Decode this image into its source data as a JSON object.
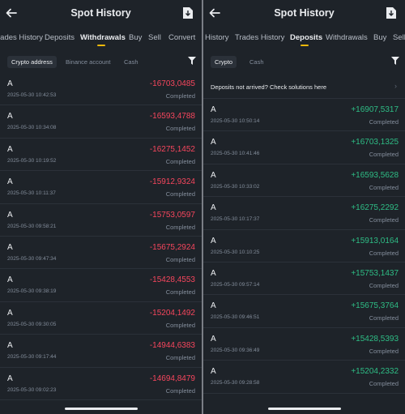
{
  "left": {
    "title": "Spot History",
    "tabs": [
      "rades History",
      "Deposits",
      "Withdrawals",
      "Buy",
      "Sell",
      "Convert"
    ],
    "filters": [
      "Crypto address",
      "Binance account",
      "Cash"
    ],
    "rows": [
      {
        "asset": "A",
        "time": "2025-05-30 10:42:53",
        "amount": "-16703,0485",
        "status": "Completed"
      },
      {
        "asset": "A",
        "time": "2025-05-30 10:34:08",
        "amount": "-16593,4788",
        "status": "Completed"
      },
      {
        "asset": "A",
        "time": "2025-05-30 10:19:52",
        "amount": "-16275,1452",
        "status": "Completed"
      },
      {
        "asset": "A",
        "time": "2025-05-30 10:11:37",
        "amount": "-15912,9324",
        "status": "Completed"
      },
      {
        "asset": "A",
        "time": "2025-05-30 09:58:21",
        "amount": "-15753,0597",
        "status": "Completed"
      },
      {
        "asset": "A",
        "time": "2025-05-30 09:47:34",
        "amount": "-15675,2924",
        "status": "Completed"
      },
      {
        "asset": "A",
        "time": "2025-05-30 09:38:19",
        "amount": "-15428,4553",
        "status": "Completed"
      },
      {
        "asset": "A",
        "time": "2025-05-30 09:30:05",
        "amount": "-15204,1492",
        "status": "Completed"
      },
      {
        "asset": "A",
        "time": "2025-05-30 09:17:44",
        "amount": "-14944,6383",
        "status": "Completed"
      },
      {
        "asset": "A",
        "time": "2025-05-30 09:02:23",
        "amount": "-14694,8479",
        "status": "Completed"
      }
    ]
  },
  "right": {
    "title": "Spot History",
    "tabs": [
      "History",
      "Trades History",
      "Deposits",
      "Withdrawals",
      "Buy",
      "Sell"
    ],
    "filters": [
      "Crypto",
      "Cash"
    ],
    "notice": "Deposits not arrived? Check solutions here",
    "rows": [
      {
        "asset": "A",
        "time": "2025-05-30 10:50:14",
        "amount": "+16907,5317",
        "status": "Completed"
      },
      {
        "asset": "A",
        "time": "2025-05-30 10:41:46",
        "amount": "+16703,1325",
        "status": "Completed"
      },
      {
        "asset": "A",
        "time": "2025-05-30 10:33:02",
        "amount": "+16593,5628",
        "status": "Completed"
      },
      {
        "asset": "A",
        "time": "2025-05-30 10:17:37",
        "amount": "+16275,2292",
        "status": "Completed"
      },
      {
        "asset": "A",
        "time": "2025-05-30 10:10:25",
        "amount": "+15913,0164",
        "status": "Completed"
      },
      {
        "asset": "A",
        "time": "2025-05-30 09:57:14",
        "amount": "+15753,1437",
        "status": "Completed"
      },
      {
        "asset": "A",
        "time": "2025-05-30 09:46:51",
        "amount": "+15675,3764",
        "status": "Completed"
      },
      {
        "asset": "A",
        "time": "2025-05-30 09:36:49",
        "amount": "+15428,5393",
        "status": "Completed"
      },
      {
        "asset": "A",
        "time": "2025-05-30 09:28:58",
        "amount": "+15204,2332",
        "status": "Completed"
      }
    ]
  },
  "colors": {
    "background": "#1e2329",
    "negative": "#f6465d",
    "positive": "#2ebd85",
    "accent": "#f0b90b"
  },
  "icons": [
    "back-arrow-icon",
    "download-file-icon",
    "filter-icon",
    "chevron-right-icon"
  ]
}
